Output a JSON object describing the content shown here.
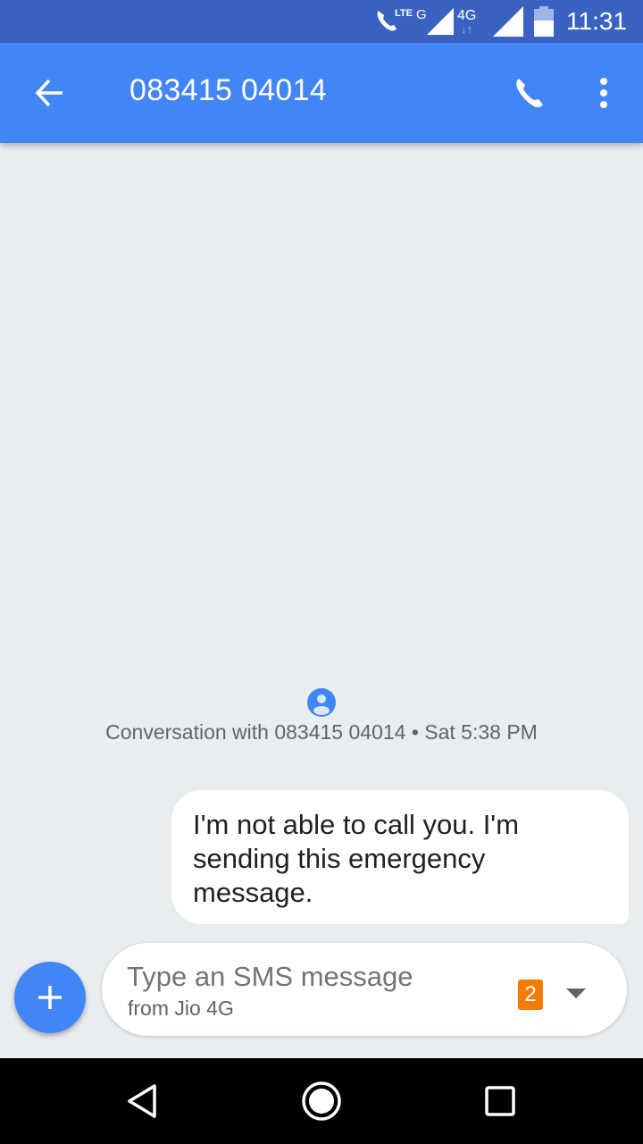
{
  "status_bar": {
    "time": "11:31",
    "lte_label": "LTE",
    "g_label": "G",
    "4g_label": "4G",
    "icons": [
      "volte-call-icon",
      "signal-icon",
      "data-arrows-icon",
      "signal-icon",
      "battery-icon"
    ]
  },
  "app_bar": {
    "title": "083415 04014",
    "icons": [
      "back-arrow-icon",
      "phone-icon",
      "more-vert-icon"
    ]
  },
  "conversation": {
    "info": "Conversation with 083415 04014 • Sat 5:38 PM",
    "messages": [
      {
        "text": "I'm not able to call you. I'm sending this emergency message."
      }
    ]
  },
  "compose": {
    "placeholder": "Type an SMS message",
    "sub_label": "from Jio 4G",
    "sim_number": "2",
    "icons": [
      "add-icon",
      "dropdown-arrow-icon"
    ]
  },
  "nav_bar": {
    "icons": [
      "back-triangle-icon",
      "home-circle-icon",
      "recents-square-icon"
    ]
  },
  "colors": {
    "status_bar": "#3a62c0",
    "app_bar": "#4285f4",
    "background": "#e9edf0",
    "sim_badge": "#f57c00"
  }
}
